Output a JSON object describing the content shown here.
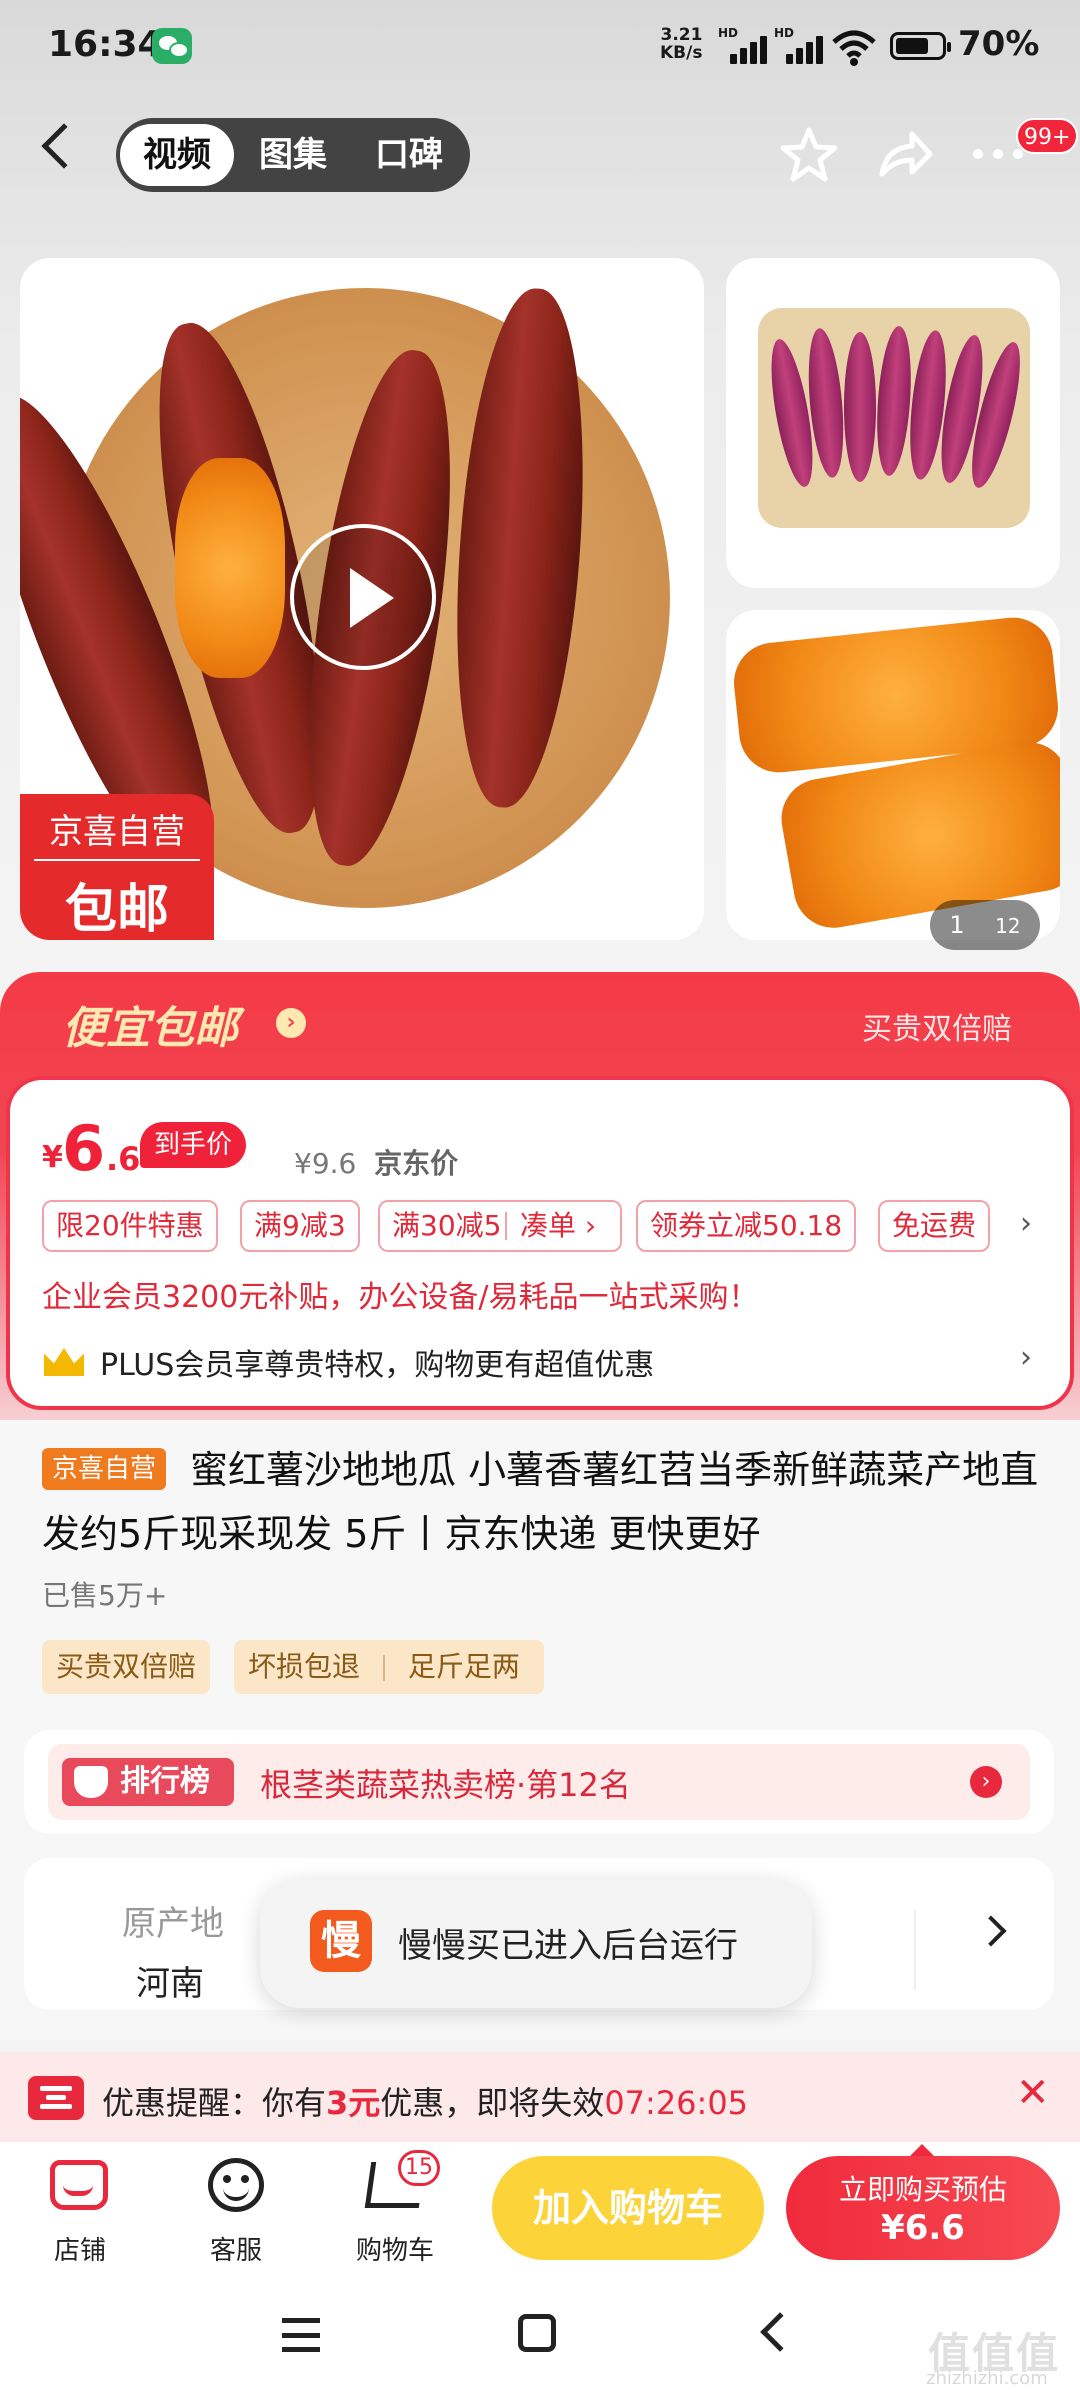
{
  "status_bar": {
    "time": "16:34",
    "net_speed_value": "3.21",
    "net_speed_unit": "KB/s",
    "hd1": "HD",
    "hd2": "HD",
    "battery": "70%"
  },
  "header": {
    "tabs": [
      {
        "label": "视频",
        "active": true
      },
      {
        "label": "图集",
        "active": false
      },
      {
        "label": "口碑",
        "active": false
      }
    ],
    "more_badge": "99+",
    "icons": [
      "back-icon",
      "star-icon",
      "share-icon",
      "more-icon"
    ]
  },
  "gallery": {
    "badge_line1": "京喜自营",
    "badge_line2": "包邮",
    "current": "1",
    "total": "12"
  },
  "promo": {
    "title": "便宜包邮",
    "right": "买贵双倍赔",
    "price_symbol": "¥",
    "price_int": "6",
    "price_dec": ".6",
    "price_tag": "到手价",
    "jd_price": "¥9.6",
    "jd_label": "京东价",
    "tags": [
      "限20件特惠",
      "满9减3",
      "满30减5",
      "凑单 ›",
      "领券立减50.18",
      "免运费"
    ],
    "business": "企业会员3200元补贴，办公设备/易耗品一站式采购！",
    "plus": "PLUS会员享尊贵特权，购物更有超值优惠"
  },
  "product": {
    "self_tag": "京喜自营",
    "title": "蜜红薯沙地地瓜 小薯香薯红苕当季新鲜蔬菜产地直发约5斤现采现发 5斤丨京东快递 更快更好",
    "sold": "已售5万+",
    "services": [
      "买贵双倍赔",
      "坏损包退",
      "足斤足两"
    ]
  },
  "ranking": {
    "logo": "排行榜",
    "text": "根茎类蔬菜热卖榜·第12名"
  },
  "origin": {
    "label": "原产地",
    "value": "河南"
  },
  "toast": {
    "icon": "慢",
    "text": "慢慢买已进入后台运行"
  },
  "reminder": {
    "prefix": "优惠提醒：你有",
    "amount": "3元",
    "suffix": "优惠，即将失效",
    "countdown": "07:26:05"
  },
  "bottom_bar": {
    "shop": "店铺",
    "service": "客服",
    "cart": "购物车",
    "cart_count": "15",
    "add_to_cart": "加入购物车",
    "buy_now": "立即购买预估",
    "buy_price": "¥6.6"
  },
  "watermark": {
    "line1": "值值值",
    "line2": "zhizhizhi.com"
  },
  "colors": {
    "accent_red": "#f0223a",
    "yellow_button": "#fcd43a",
    "self_tag_orange": "#f07a1e"
  }
}
